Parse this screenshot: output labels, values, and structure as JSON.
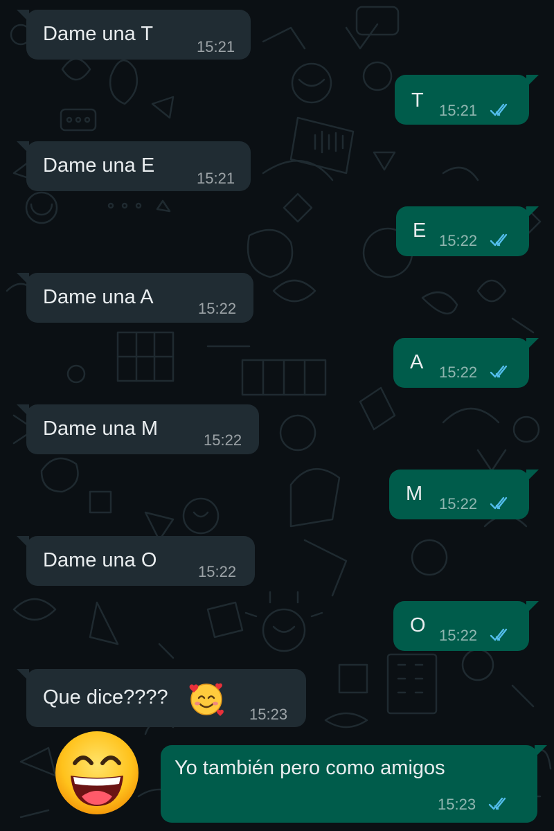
{
  "colors": {
    "background": "#0b1014",
    "incoming_bubble": "#202c33",
    "outgoing_bubble": "#005c4b",
    "text": "#e9edef",
    "read_ticks": "#53bdeb"
  },
  "messages": [
    {
      "direction": "incoming",
      "text": "Dame una T",
      "time": "15:21"
    },
    {
      "direction": "outgoing",
      "text": "T",
      "time": "15:21",
      "status": "read-double-check-icon"
    },
    {
      "direction": "incoming",
      "text": "Dame una E",
      "time": "15:21"
    },
    {
      "direction": "outgoing",
      "text": "E",
      "time": "15:22",
      "status": "read-double-check-icon"
    },
    {
      "direction": "incoming",
      "text": "Dame una A",
      "time": "15:22"
    },
    {
      "direction": "outgoing",
      "text": "A",
      "time": "15:22",
      "status": "read-double-check-icon"
    },
    {
      "direction": "incoming",
      "text": "Dame una M",
      "time": "15:22"
    },
    {
      "direction": "outgoing",
      "text": "M",
      "time": "15:22",
      "status": "read-double-check-icon"
    },
    {
      "direction": "incoming",
      "text": "Dame una O",
      "time": "15:22"
    },
    {
      "direction": "outgoing",
      "text": "O",
      "time": "15:22",
      "status": "read-double-check-icon"
    },
    {
      "direction": "incoming",
      "text": "Que dice????",
      "time": "15:23",
      "emoji": "smiling-face-with-hearts-icon"
    },
    {
      "direction": "outgoing",
      "text": "Yo también pero como amigos",
      "time": "15:23",
      "status": "read-double-check-icon"
    }
  ],
  "overlay_emoji": "grinning-face-with-smiling-eyes-icon"
}
